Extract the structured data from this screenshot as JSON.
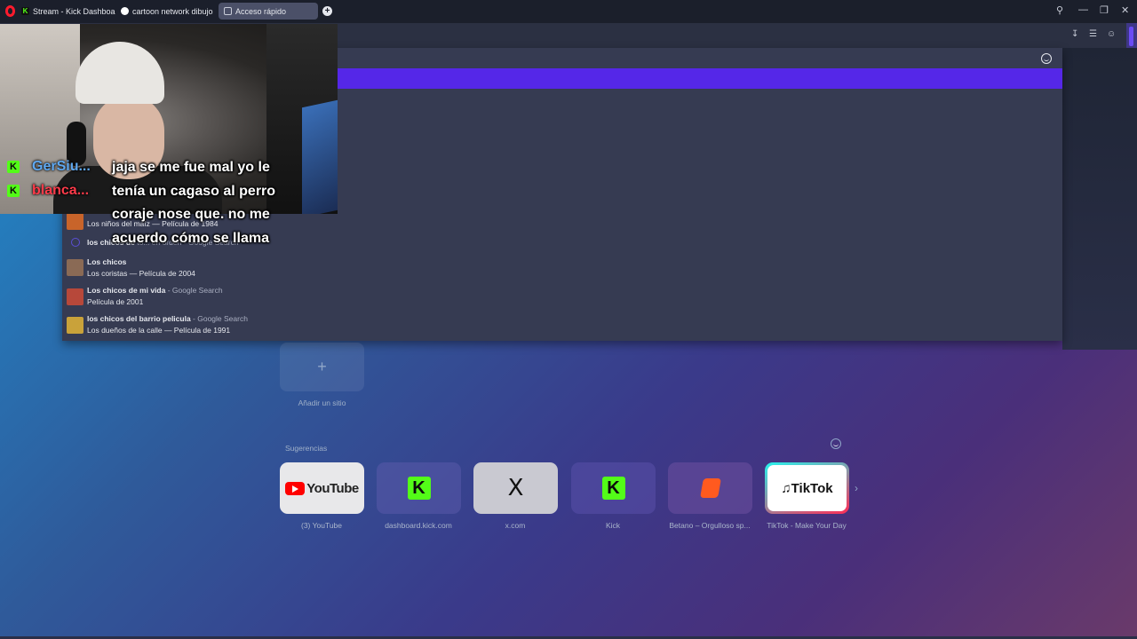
{
  "tabs": [
    {
      "label": "Stream - Kick Dashboard",
      "icon": "kick-icon"
    },
    {
      "label": "cartoon network dibujos",
      "icon": "google-icon"
    },
    {
      "label": "Acceso rápido",
      "icon": "grid-icon",
      "active": true
    }
  ],
  "suggestions": [
    {
      "title_bold": "",
      "title_rest": "",
      "subtitle": "Los niños del maíz — Película de 1984",
      "thumb_color": "#c8642a"
    },
    {
      "title_bold": "los chicos de",
      "title_rest": " to... en orden - Google Search",
      "subtitle": "",
      "thumb_color": "#5b4fd6"
    },
    {
      "title_bold": "Los chicos",
      "title_rest": "",
      "subtitle": "Los coristas — Película de 2004",
      "thumb_color": "#8a6a55"
    },
    {
      "title_bold": "Los chicos de mi vida",
      "title_rest": " - Google Search",
      "subtitle": "Película de 2001",
      "thumb_color": "#b7483a"
    },
    {
      "title_bold": "los chicos del barrio pelicula",
      "title_rest": " - Google Search",
      "subtitle": "Los dueños de la calle — Película de 1991",
      "thumb_color": "#c9a23a"
    }
  ],
  "chat": [
    {
      "name": "GerSiu...",
      "color": "#5fa8f0"
    },
    {
      "name": "blanca...",
      "color": "#ff3b4a"
    }
  ],
  "chat_message": "jaja se me fue mal yo le tenía un cagaso al perro coraje nose que. no me acuerdo cómo se llama",
  "speed_dial": {
    "add_symbol": "+",
    "add_label": "Añadir un sitio",
    "suggestions_title": "Sugerencias",
    "tiles": [
      {
        "label": "(3) YouTube",
        "logo_text": "YouTube"
      },
      {
        "label": "dashboard.kick.com",
        "logo_text": "K"
      },
      {
        "label": "x.com",
        "logo_text": "X"
      },
      {
        "label": "Kick",
        "logo_text": "K"
      },
      {
        "label": "Betano – Orgulloso sp...",
        "logo_text": ""
      },
      {
        "label": "TikTok - Make Your Day",
        "logo_text": "TikTok"
      }
    ]
  },
  "colors": {
    "accent_purple": "#5527e8",
    "kick_green": "#53fc18",
    "opera_red": "#ff1b2d"
  }
}
